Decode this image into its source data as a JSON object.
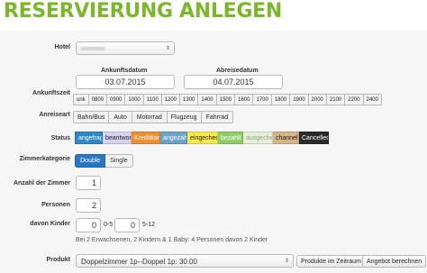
{
  "page": {
    "title": "RESERVIERUNG ANLEGEN"
  },
  "form": {
    "hotel": {
      "label": "Hotel",
      "value": "",
      "chevron": "⇕"
    },
    "dates": {
      "arrival_label": "Ankunftsdatum",
      "arrival_value": "03.07.2015",
      "departure_label": "Abreisedatum",
      "departure_value": "04.07.2015"
    },
    "arrival_time": {
      "label": "Ankunftszeit",
      "options": [
        "unk",
        "0800",
        "0900",
        "1000",
        "1100",
        "1200",
        "1300",
        "1400",
        "1500",
        "1600",
        "1700",
        "1800",
        "1900",
        "2000",
        "2100",
        "2200",
        "2400"
      ]
    },
    "travel_mode": {
      "label": "Anreiseart",
      "options": [
        "Bahn/Bus",
        "Auto",
        "Motorrad",
        "Flugzeug",
        "Fahrrad"
      ]
    },
    "status": {
      "label": "Status",
      "options": [
        {
          "label": "angefragt",
          "color": "#2f86c9",
          "text_color": "#ffffff"
        },
        {
          "label": "beantwortet",
          "color": "#d7d3ee",
          "text_color": "#222222"
        },
        {
          "label": "Kreditkarte",
          "color": "#ef8f34",
          "text_color": "#ffffff"
        },
        {
          "label": "angezahlt",
          "color": "#6ea3c8",
          "text_color": "#ffffff"
        },
        {
          "label": "eingecheckt",
          "color": "#f6ea4c",
          "text_color": "#222222"
        },
        {
          "label": "bezahlt",
          "color": "#8fcc6a",
          "text_color": "#ffffff"
        },
        {
          "label": "ausgecheckt",
          "color": "#e4f1d6",
          "text_color": "#9a9a9a"
        },
        {
          "label": "channel",
          "color": "#d6b48a",
          "text_color": "#222222"
        },
        {
          "label": "Cancelled",
          "color": "#2a2a2a",
          "text_color": "#ffffff"
        }
      ]
    },
    "room_category": {
      "label": "Zimmerkategorie",
      "selected": "Double",
      "other": "Single"
    },
    "rooms": {
      "label": "Anzahl der Zimmer",
      "value": "1"
    },
    "persons": {
      "label": "Personen",
      "value": "2"
    },
    "children": {
      "label": "davon Kinder",
      "value_a": "0",
      "range_a": "0-5",
      "value_b": "0",
      "range_b": "5-12",
      "note": "Bei 2 Erwachsenen, 2 Kindern & 1 Baby: 4 Personen davon 2 Kinder"
    },
    "product": {
      "label": "Produkt",
      "value": "Doppelzimmer 1p--Doppel 1p: 30.00",
      "chevron": "⇕",
      "period_button": "Produkte im Zeitraum",
      "offer_button": "Angebot berechnen"
    }
  }
}
